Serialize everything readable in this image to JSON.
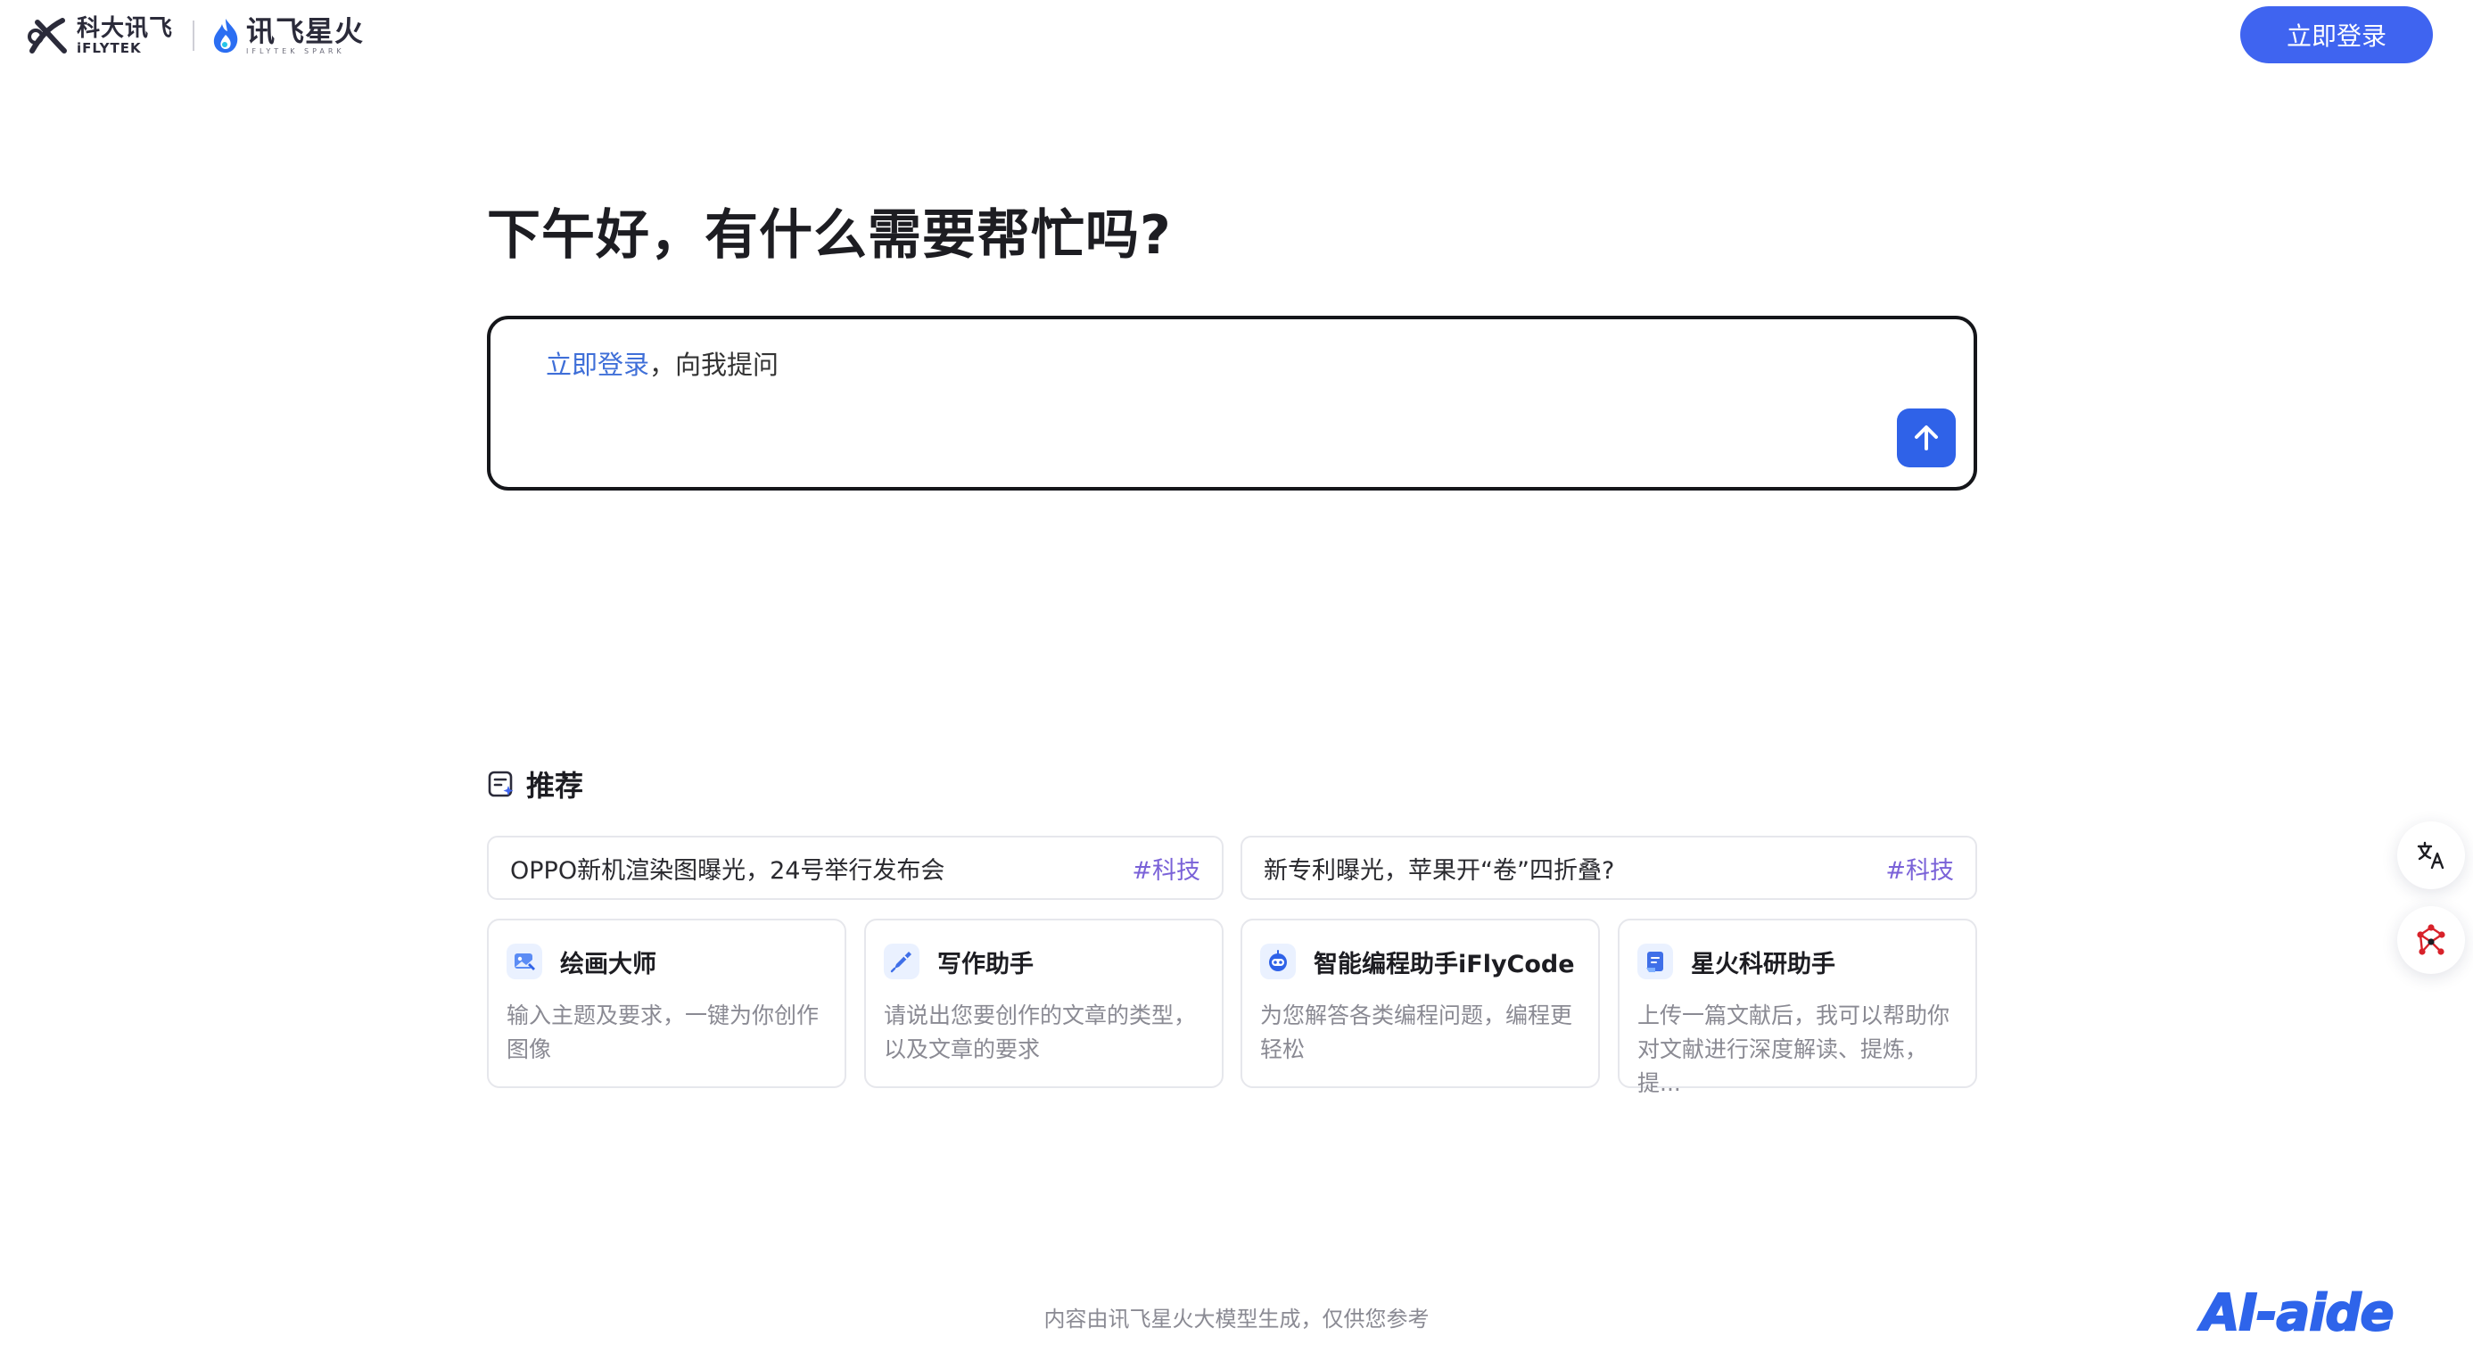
{
  "header": {
    "logo_iflytek_cn": "科大讯飞",
    "logo_iflytek_en": "iFLYTEK",
    "logo_spark_cn": "讯飞星火",
    "logo_spark_en": "IFLYTEK SPARK",
    "login_button_label": "立即登录"
  },
  "greeting": "下午好，有什么需要帮忙吗?",
  "input": {
    "login_link": "立即登录",
    "placeholder_rest": "，向我提问"
  },
  "recommend": {
    "title": "推荐",
    "news": [
      {
        "text": "OPPO新机渲染图曝光，24号举行发布会",
        "tag": "#科技"
      },
      {
        "text": "新专利曝光，苹果开“卷”四折叠?",
        "tag": "#科技"
      }
    ],
    "agents": [
      {
        "name": "绘画大师",
        "desc": "输入主题及要求，一键为你创作图像",
        "icon": "paint-icon"
      },
      {
        "name": "写作助手",
        "desc": "请说出您要创作的文章的类型，以及文章的要求",
        "icon": "pen-icon"
      },
      {
        "name": "智能编程助手iFlyCode",
        "desc": "为您解答各类编程问题，编程更轻松",
        "icon": "robot-icon"
      },
      {
        "name": "星火科研助手",
        "desc": "上传一篇文献后，我可以帮助你对文献进行深度解读、提炼，提...",
        "icon": "document-icon"
      }
    ]
  },
  "footer": {
    "note": "内容由讯飞星火大模型生成，仅供您参考",
    "brand": "AI-aide"
  },
  "side_buttons": [
    {
      "icon": "translate-icon"
    },
    {
      "icon": "graph-icon"
    }
  ],
  "colors": {
    "accent": "#3f64f0",
    "link": "#3f6fd8",
    "tag": "#7a62d8",
    "muted": "#8a8a93"
  }
}
